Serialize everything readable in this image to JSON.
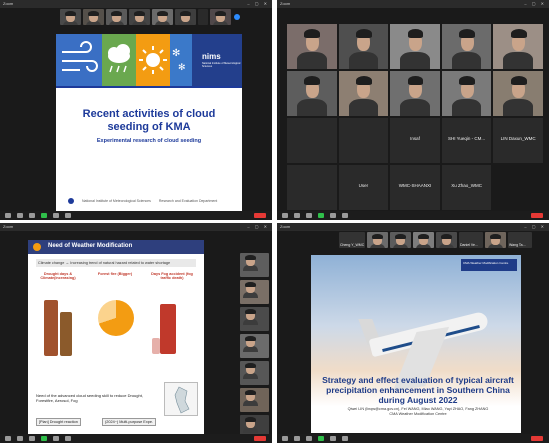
{
  "window_titles": [
    "Zoom",
    "Zoom",
    "Zoom",
    "Zoom"
  ],
  "q1": {
    "slide": {
      "logo": "nims",
      "logo_sub": "National Institute of Meteorological Sciences",
      "title": "Recent activities of cloud seeding of KMA",
      "subtitle": "Experimental research of cloud seeding",
      "footer_left": "National Institute of Meteorological Sciences",
      "footer_right": "Research and Evaluation Department"
    }
  },
  "q2": {
    "tiles": [
      {
        "label": ""
      },
      {
        "label": ""
      },
      {
        "label": ""
      },
      {
        "label": ""
      },
      {
        "label": ""
      },
      {
        "label": ""
      },
      {
        "label": ""
      },
      {
        "label": ""
      },
      {
        "label": ""
      },
      {
        "label": ""
      },
      {
        "label": "",
        "center": ""
      },
      {
        "label": "",
        "center": ""
      },
      {
        "label": "",
        "center": "Insaf"
      },
      {
        "label": "",
        "center": "SHI Yueqin - CM..."
      },
      {
        "label": "",
        "center": "LIN Daxun_WMC"
      },
      {
        "label": "",
        "center": ""
      },
      {
        "label": "",
        "center": "User"
      },
      {
        "label": "",
        "center": "WMC-SHAANXI"
      },
      {
        "label": "",
        "center": "Xu Zhao_WMC"
      },
      {
        "label": "",
        "center": ""
      }
    ]
  },
  "q3": {
    "slide": {
      "title": "Need of Weather Modification",
      "banner": "Climate change → Increasing trend of natural hazard related to water shortage",
      "col1": "Drought days & Climate(increasing)",
      "col2": "Forest fire (Bigger)",
      "col3": "Days Fog accident (fog traffic death)",
      "note": "Need of the advanced cloud seeding skill to reduce Drought, Forestfire, Aerosol, Fog",
      "box1": "[Plan] Drought reaction",
      "box2": "(2024~) Multi-purpose Expe."
    }
  },
  "q4": {
    "top_names": [
      "Cheng Y_WMC",
      "Daniel Ve...",
      "Wang Ta..."
    ],
    "slide": {
      "logo": "CMA Weather Modification Centre",
      "title": "Strategy and effect evaluation of typical aircraft precipitation enhancement in Southern China during August 2022",
      "authors": "Qiwei LIN (linqw@cma.gov.cn), Fei WANG, Miao WANG, Yayi ZHAO, Fang ZHANG",
      "org": "CMA Weather Modification Centre"
    }
  },
  "colors": {
    "slide_blue": "#1d3a9a",
    "band_blue": "#3a6fc4",
    "band_green": "#6aa84f",
    "band_orange": "#f39c12",
    "band_navy": "#233f8c",
    "toolbar_red": "#e53935"
  }
}
